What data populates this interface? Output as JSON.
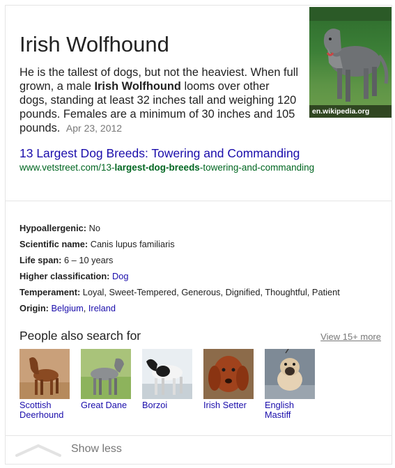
{
  "entity": {
    "title": "Irish Wolfhound",
    "snippet_part1": "He is the tallest of dogs, but not the heaviest. When full grown, a male ",
    "snippet_bold": "Irish Wolfhound",
    "snippet_part2": " looms over other dogs, standing at least 32 inches tall and weighing 120 pounds. Females are a minimum of 30 inches and 105 pounds.",
    "date": "Apr 23, 2012",
    "image_caption": "en.wikipedia.org"
  },
  "source": {
    "title": "13 Largest Dog Breeds: Towering and Commanding",
    "url_prefix": "www.vetstreet.com/13-",
    "url_bold": "largest-dog-breeds",
    "url_suffix": "-towering-and-commanding"
  },
  "facts": [
    {
      "label": "Hypoallergenic:",
      "value": "No"
    },
    {
      "label": "Scientific name:",
      "value": "Canis lupus familiaris"
    },
    {
      "label": "Life span:",
      "value": "6 – 10 years"
    },
    {
      "label": "Higher classification:",
      "links": [
        "Dog"
      ]
    },
    {
      "label": "Temperament:",
      "value": "Loyal, Sweet-Tempered, Generous, Dignified, Thoughtful, Patient"
    },
    {
      "label": "Origin:",
      "links": [
        "Belgium",
        "Ireland"
      ]
    }
  ],
  "people_also_search": {
    "title": "People also search for",
    "view_more": "View 15+ more",
    "items": [
      {
        "line1": "Scottish",
        "line2": "Deerhound"
      },
      {
        "line1": "Great Dane",
        "line2": ""
      },
      {
        "line1": "Borzoi",
        "line2": ""
      },
      {
        "line1": "Irish Setter",
        "line2": ""
      },
      {
        "line1": "English",
        "line2": "Mastiff"
      }
    ]
  },
  "footer": {
    "show_less": "Show less"
  }
}
